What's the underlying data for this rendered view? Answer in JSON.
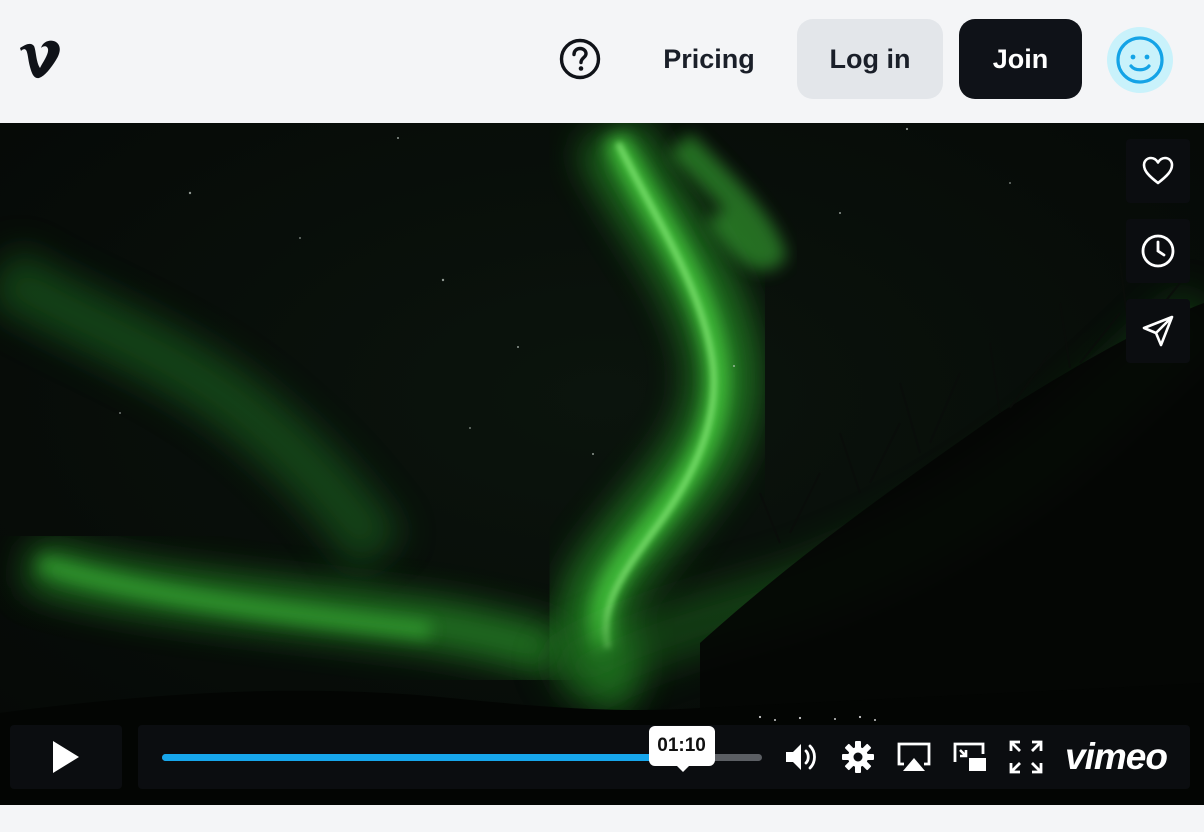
{
  "header": {
    "logo_icon": "vimeo-v-logo-icon",
    "help_icon": "question-circle-icon",
    "pricing_label": "Pricing",
    "login_label": "Log in",
    "join_label": "Join",
    "avatar_icon": "smiley-face-icon"
  },
  "video": {
    "description_icon_names": [
      "heart-icon",
      "clock-icon",
      "send-icon"
    ],
    "tooltip_time": "01:10",
    "progress_fraction": 0.866,
    "controls": {
      "play_icon": "play-icon",
      "volume_icon": "volume-icon",
      "settings_icon": "gear-icon",
      "airplay_icon": "airplay-icon",
      "pip_icon": "picture-in-picture-icon",
      "fullscreen_icon": "fullscreen-icon",
      "brand_label": "vimeo"
    }
  },
  "colors": {
    "accent": "#17a6ec",
    "header_bg": "#f4f5f7",
    "join_bg": "#0f1218",
    "login_bg": "#e3e6ea",
    "avatar_bg": "#c9f2fb"
  }
}
